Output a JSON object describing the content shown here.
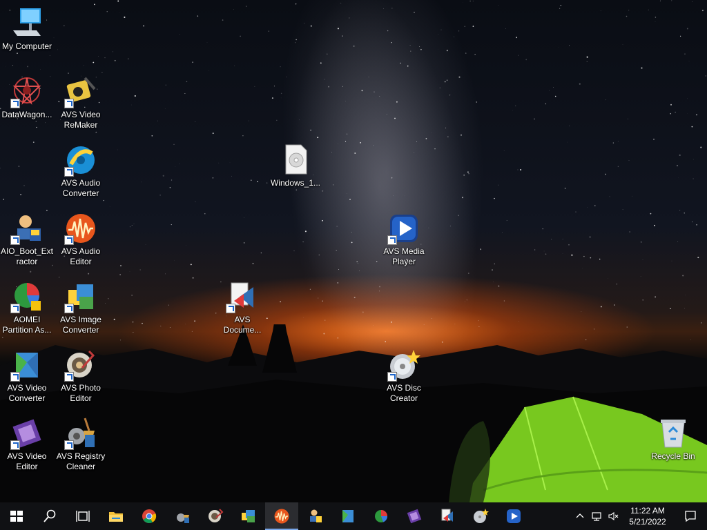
{
  "desktop": {
    "icons": [
      {
        "name": "my-computer",
        "line1": "My Computer",
        "line2": ""
      },
      {
        "name": "datawagon",
        "line1": "DataWagon...",
        "line2": ""
      },
      {
        "name": "avs-video-remaker",
        "line1": "AVS Video",
        "line2": "ReMaker"
      },
      {
        "name": "avs-audio-converter",
        "line1": "AVS Audio",
        "line2": "Converter"
      },
      {
        "name": "aio-boot-extractor",
        "line1": "AIO_Boot_Ext",
        "line2": "ractor"
      },
      {
        "name": "avs-audio-editor",
        "line1": "AVS Audio",
        "line2": "Editor"
      },
      {
        "name": "aomei-partition",
        "line1": "AOMEI",
        "line2": "Partition As..."
      },
      {
        "name": "avs-image-converter",
        "line1": "AVS Image",
        "line2": "Converter"
      },
      {
        "name": "avs-video-converter",
        "line1": "AVS Video",
        "line2": "Converter"
      },
      {
        "name": "avs-photo-editor",
        "line1": "AVS Photo",
        "line2": "Editor"
      },
      {
        "name": "avs-video-editor",
        "line1": "AVS Video",
        "line2": "Editor"
      },
      {
        "name": "avs-registry-cleaner",
        "line1": "AVS Registry",
        "line2": "Cleaner"
      },
      {
        "name": "windows-iso",
        "line1": "Windows_1...",
        "line2": ""
      },
      {
        "name": "avs-document",
        "line1": "AVS",
        "line2": "Docume..."
      },
      {
        "name": "avs-media-player",
        "line1": "AVS Media",
        "line2": "Player"
      },
      {
        "name": "avs-disc-creator",
        "line1": "AVS Disc",
        "line2": "Creator"
      },
      {
        "name": "recycle-bin",
        "line1": "Recycle Bin",
        "line2": ""
      }
    ]
  },
  "taskbar": {
    "items": [
      "start",
      "search",
      "task-view",
      "file-explorer",
      "chrome",
      "avs-registry-cleaner",
      "avs-photo-editor",
      "avs-image-converter",
      "avs-audio-editor",
      "aio-boot-extractor",
      "avs-video-converter",
      "aomei-partition",
      "avs-video-editor",
      "avs-document",
      "avs-disc-creator",
      "avs-media-player"
    ],
    "active": "avs-audio-editor"
  },
  "tray": {
    "time": "11:22 AM",
    "date": "5/21/2022"
  },
  "colors": {
    "taskbar": "#101114",
    "accent": "#7aa7e8",
    "tent": "#7ed321"
  }
}
